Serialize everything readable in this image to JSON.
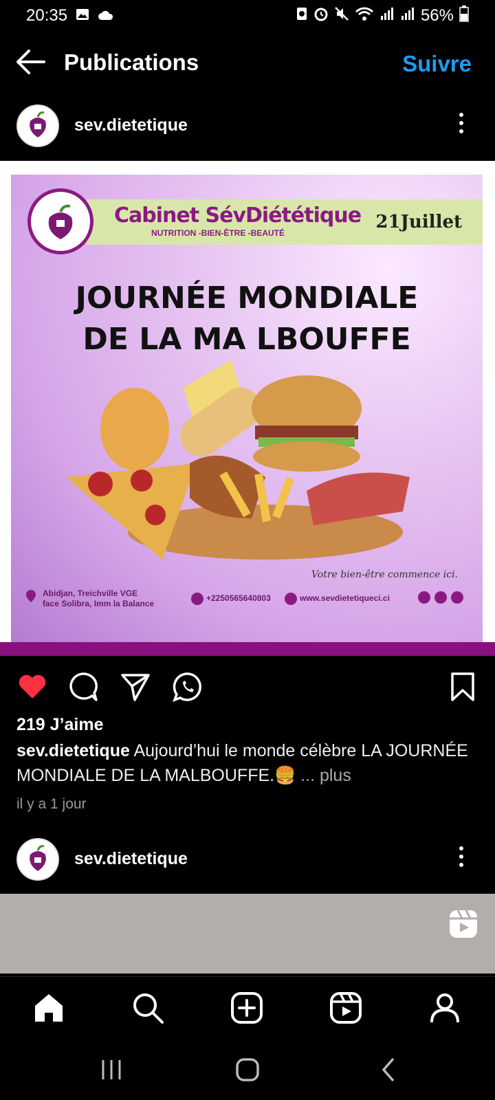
{
  "status_bar": {
    "time": "20:35",
    "battery": "56%"
  },
  "header": {
    "title": "Publications",
    "follow_label": "Suivre"
  },
  "post": {
    "username": "sev.dietetique",
    "image": {
      "brand_name": "Cabinet SévDiététique",
      "brand_tagline": "NUTRITION -BIEN-ÊTRE -BEAUTÉ",
      "date": "21Juillet",
      "headline_line1": "JOURNÉE MONDIALE",
      "headline_line2": "DE LA MA LBOUFFE",
      "slogan": "Votre bien-être commence ici.",
      "address_line1": "Abidjan, Treichville VGE",
      "address_line2": "face Solibra, Imm la Balance",
      "phone": "+2250565640803",
      "website": "www.sevdietetiqueci.ci"
    },
    "likes": "219 J’aime",
    "caption_user": "sev.dietetique",
    "caption_text": " Aujourd’hui le monde célèbre LA JOURNÉE MONDIALE DE LA MALBOUFFE.🍔",
    "more_label": "... plus",
    "timestamp": "il y a 1 jour"
  },
  "next_post": {
    "username": "sev.dietetique"
  },
  "icons": {
    "like": "heart-filled-icon",
    "comment": "comment-icon",
    "share": "send-icon",
    "whatsapp": "whatsapp-icon",
    "save": "bookmark-icon"
  },
  "colors": {
    "accent": "#1d9bf0",
    "like": "#ff3040",
    "brand": "#8a1a82"
  }
}
